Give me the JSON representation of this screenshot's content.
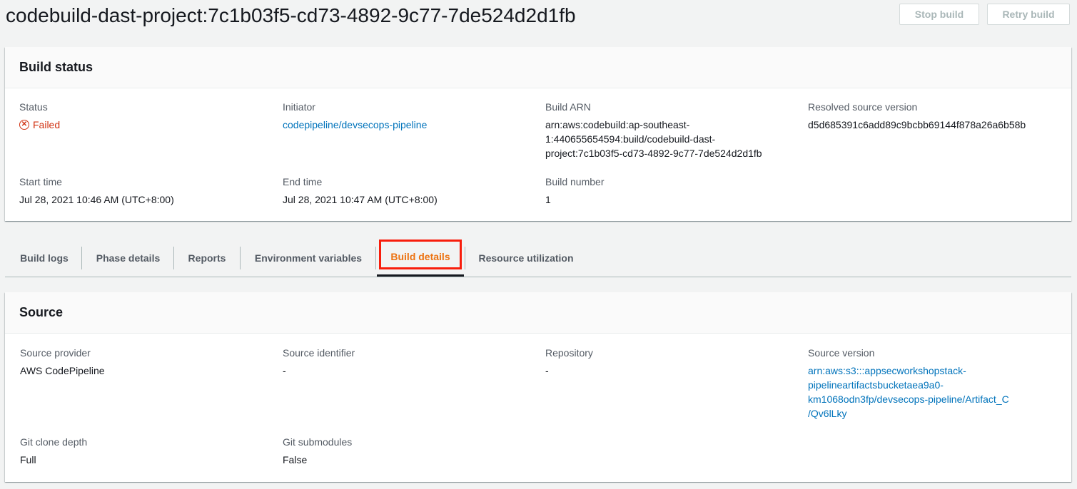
{
  "header": {
    "title": "codebuild-dast-project:7c1b03f5-cd73-4892-9c77-7de524d2d1fb",
    "stop_label": "Stop build",
    "retry_label": "Retry build"
  },
  "build_status": {
    "heading": "Build status",
    "status_label": "Status",
    "status_value": "Failed",
    "status_icon": "failed-icon",
    "initiator_label": "Initiator",
    "initiator_value": "codepipeline/devsecops-pipeline",
    "arn_label": "Build ARN",
    "arn_lines": [
      "arn:aws:codebuild:ap-southeast-",
      "1:440655654594:build/codebuild-dast-",
      "project:7c1b03f5-cd73-4892-9c77-7de524d2d1fb"
    ],
    "resolved_label": "Resolved source version",
    "resolved_value": "d5d685391c6add89c9bcbb69144f878a26a6b58b",
    "start_label": "Start time",
    "start_value": "Jul 28, 2021 10:46 AM (UTC+8:00)",
    "end_label": "End time",
    "end_value": "Jul 28, 2021 10:47 AM (UTC+8:00)",
    "number_label": "Build number",
    "number_value": "1"
  },
  "tabs": [
    {
      "label": "Build logs"
    },
    {
      "label": "Phase details"
    },
    {
      "label": "Reports"
    },
    {
      "label": "Environment variables"
    },
    {
      "label": "Build details"
    },
    {
      "label": "Resource utilization"
    }
  ],
  "colors": {
    "active_tab": "#ec7211",
    "highlight": "#f81d0c",
    "link": "#0073bb",
    "error": "#d13212"
  },
  "source": {
    "heading": "Source",
    "provider_label": "Source provider",
    "provider_value": "AWS CodePipeline",
    "identifier_label": "Source identifier",
    "identifier_value": "-",
    "repository_label": "Repository",
    "repository_value": "-",
    "version_label": "Source version",
    "version_lines": [
      "arn:aws:s3:::appsecworkshopstack-",
      "pipelineartifactsbucketaea9a0-",
      "km1068odn3fp/devsecops-pipeline/Artifact_C",
      "/Qv6lLky"
    ],
    "depth_label": "Git clone depth",
    "depth_value": "Full",
    "submodules_label": "Git submodules",
    "submodules_value": "False"
  }
}
